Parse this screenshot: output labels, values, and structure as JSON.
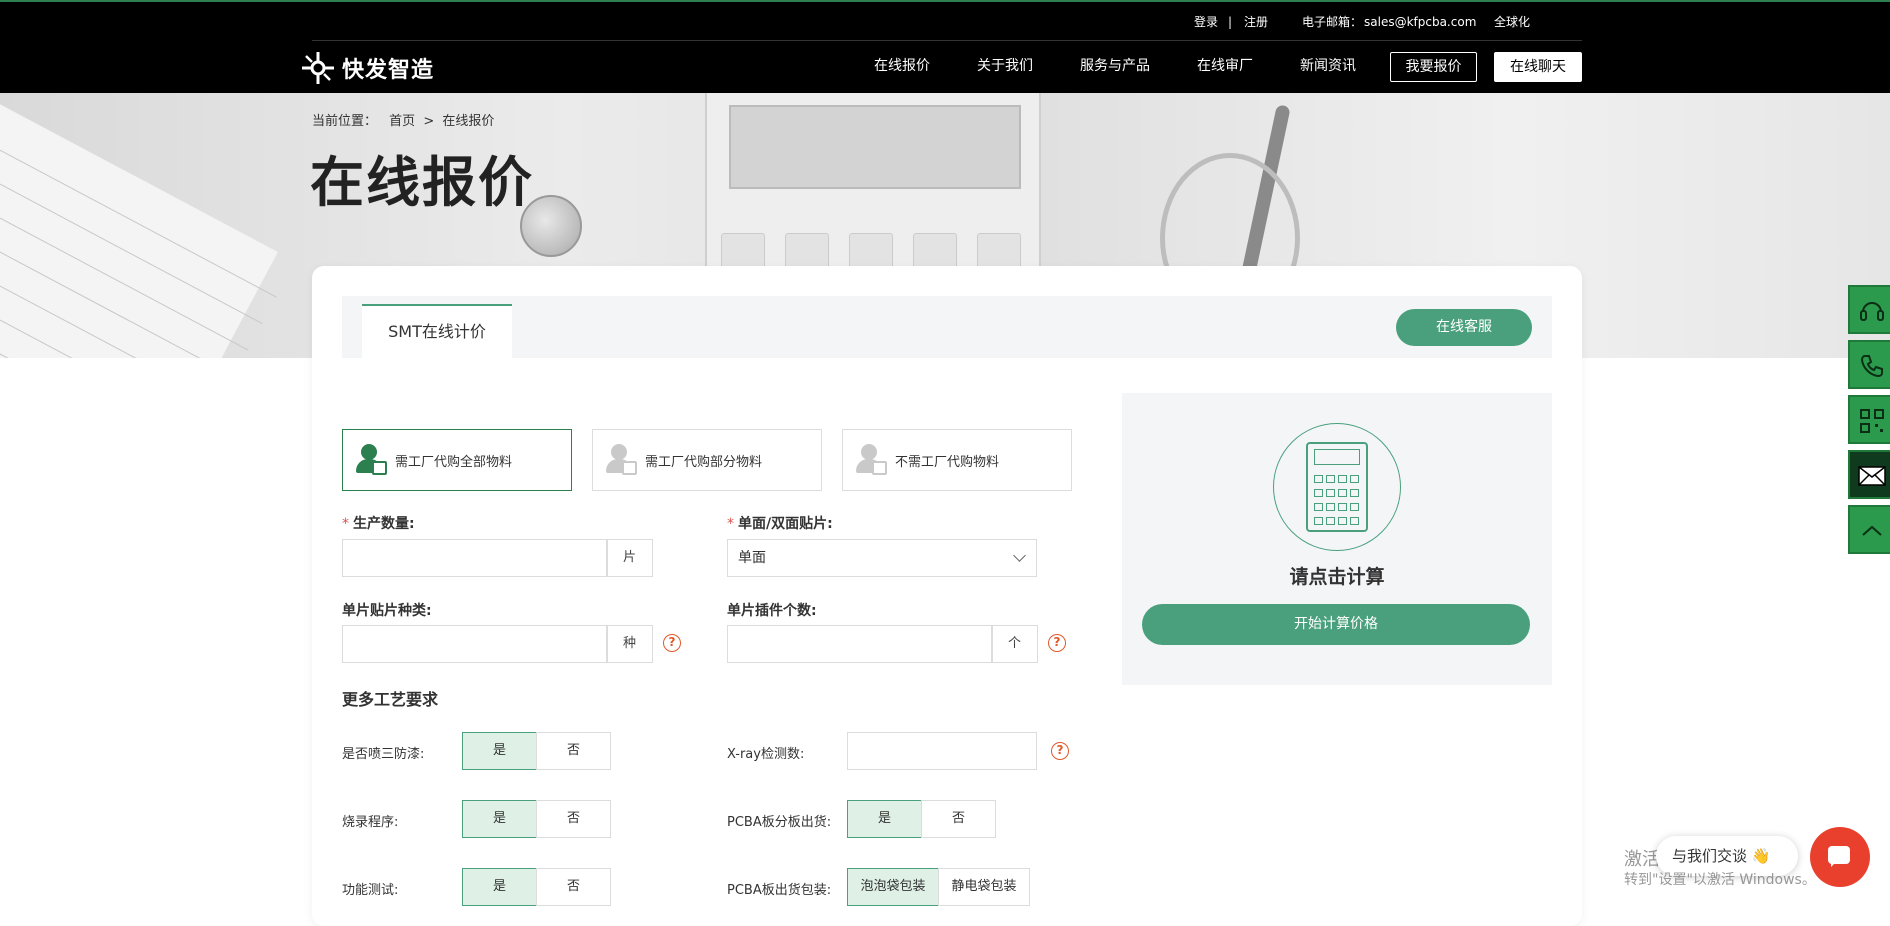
{
  "header": {
    "utility": {
      "login": "登录",
      "separator": "|",
      "register": "注册",
      "email_label": "电子邮箱：",
      "email": "sales@kfpcba.com",
      "global": "全球化"
    },
    "logo_text": "快发智造",
    "nav": [
      "在线报价",
      "关于我们",
      "服务与产品",
      "在线审厂",
      "新闻资讯"
    ],
    "quote_button": "我要报价",
    "chat_button": "在线聊天"
  },
  "banner": {
    "breadcrumb_label": "当前位置：",
    "breadcrumb_home": "首页",
    "breadcrumb_sep": ">",
    "breadcrumb_current": "在线报价",
    "title": "在线报价"
  },
  "quote_panel": {
    "tab": "SMT在线计价",
    "service_button": "在线客服",
    "material_options": [
      {
        "label": "需工厂代购全部物料",
        "selected": true
      },
      {
        "label": "需工厂代购部分物料",
        "selected": false
      },
      {
        "label": "不需工厂代购物料",
        "selected": false
      }
    ],
    "fields": {
      "quantity_label": "生产数量:",
      "quantity_value": "",
      "quantity_unit": "片",
      "side_label": "单面/双面贴片:",
      "side_value": "单面",
      "types_label": "单片贴片种类:",
      "types_value": "",
      "types_unit": "种",
      "plugin_label": "单片插件个数:",
      "plugin_value": "",
      "plugin_unit": "个",
      "required_mark": "*",
      "help_glyph": "?"
    },
    "more_section_title": "更多工艺要求",
    "process": {
      "coating_label": "是否喷三防漆:",
      "burn_label": "烧录程序:",
      "function_label": "功能测试:",
      "xray_label": "X-ray检测数:",
      "xray_value": "",
      "split_label": "PCBA板分板出货:",
      "packaging_label": "PCBA板出货包装:",
      "yes": "是",
      "no": "否",
      "bubble_bag": "泡泡袋包装",
      "esd_bag": "静电袋包装"
    }
  },
  "calculator": {
    "title": "请点击计算",
    "button": "开始计算价格"
  },
  "side_tools": [
    "headset-icon",
    "phone-icon",
    "qr-code-icon",
    "mail-icon",
    "back-to-top-icon"
  ],
  "chat_widget": {
    "label": "与我们交谈",
    "emoji": "👋"
  },
  "watermark": {
    "line1": "激活",
    "line2": "转到\"设置\"以激活 Windows。"
  },
  "colors": {
    "brand_green": "#4aa07d",
    "dark_green": "#2c7f4e",
    "chat_red": "#e8402d",
    "header_black": "#000000"
  }
}
